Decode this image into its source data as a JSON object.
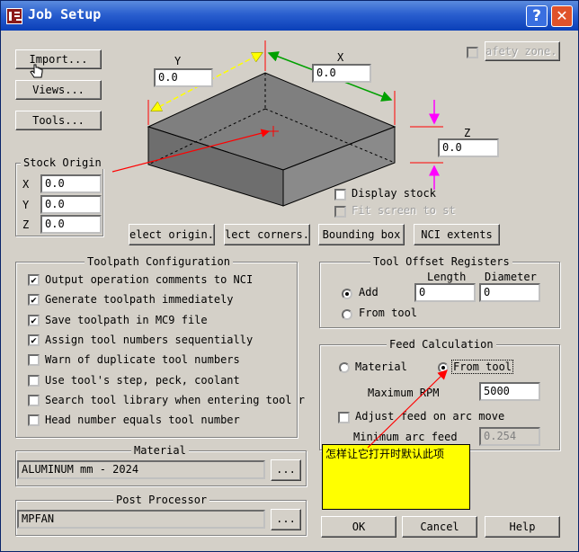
{
  "window": {
    "title": "Job Setup",
    "help_glyph": "?",
    "close_glyph": "✕"
  },
  "buttons": {
    "import": "Import...",
    "views": "Views...",
    "tools": "Tools...",
    "safety_zone": "afety zone..",
    "select_origin": "elect origin..",
    "select_corners": "lect corners..",
    "bounding_box": "Bounding box",
    "nci_extents": "NCI extents",
    "material_browse": "...",
    "post_browse": "...",
    "ok": "OK",
    "cancel": "Cancel",
    "help": "Help"
  },
  "dimensions": {
    "y_label": "Y",
    "y_value": "0.0",
    "x_label": "X",
    "x_value": "0.0",
    "z_label": "Z",
    "z_value": "0.0"
  },
  "stock_origin": {
    "title": "Stock Origin",
    "x_label": "X",
    "x_value": "0.0",
    "y_label": "Y",
    "y_value": "0.0",
    "z_label": "Z",
    "z_value": "0.0"
  },
  "stock_options": {
    "display_stock": "Display stock",
    "fit_screen": "Fit screen to st"
  },
  "toolpath_config": {
    "title": "Toolpath Configuration",
    "items": [
      {
        "label": "Output operation comments to NCI",
        "checked": "✔"
      },
      {
        "label": "Generate toolpath immediately",
        "checked": "✔"
      },
      {
        "label": "Save toolpath in MC9 file",
        "checked": "✔"
      },
      {
        "label": "Assign tool numbers sequentially",
        "checked": "✔"
      },
      {
        "label": "Warn of duplicate tool numbers",
        "checked": ""
      },
      {
        "label": "Use tool's step, peck, coolant",
        "checked": ""
      },
      {
        "label": "Search tool library when entering tool r",
        "checked": ""
      },
      {
        "label": "Head number equals tool number",
        "checked": ""
      }
    ]
  },
  "tool_offset": {
    "title": "Tool Offset Registers",
    "length_header": "Length",
    "diameter_header": "Diameter",
    "add_label": "Add",
    "from_tool_label": "From tool",
    "length_value": "0",
    "diameter_value": "0"
  },
  "feed_calc": {
    "title": "Feed Calculation",
    "material_label": "Material",
    "from_tool_label": "From tool",
    "max_rpm_label": "Maximum RPM",
    "max_rpm_value": "5000",
    "adjust_label": "Adjust feed on arc move",
    "min_arc_label": "Minimum arc feed",
    "min_arc_value": "0.254"
  },
  "material": {
    "title": "Material",
    "value": "ALUMINUM mm - 2024"
  },
  "post_processor": {
    "title": "Post Processor",
    "value": "MPFAN"
  },
  "annotation": {
    "text": "怎样让它打开时默认此项"
  },
  "colors": {
    "dialog_bg": "#d4d0c8",
    "title_bar": "#0a3fb8",
    "stock_face": "#808080",
    "note_bg": "#ffff00",
    "x_arrow": "#00a000",
    "y_arrow": "#ffff00",
    "z_arrow": "#ff00ff",
    "origin_arrow": "#ff0000"
  }
}
